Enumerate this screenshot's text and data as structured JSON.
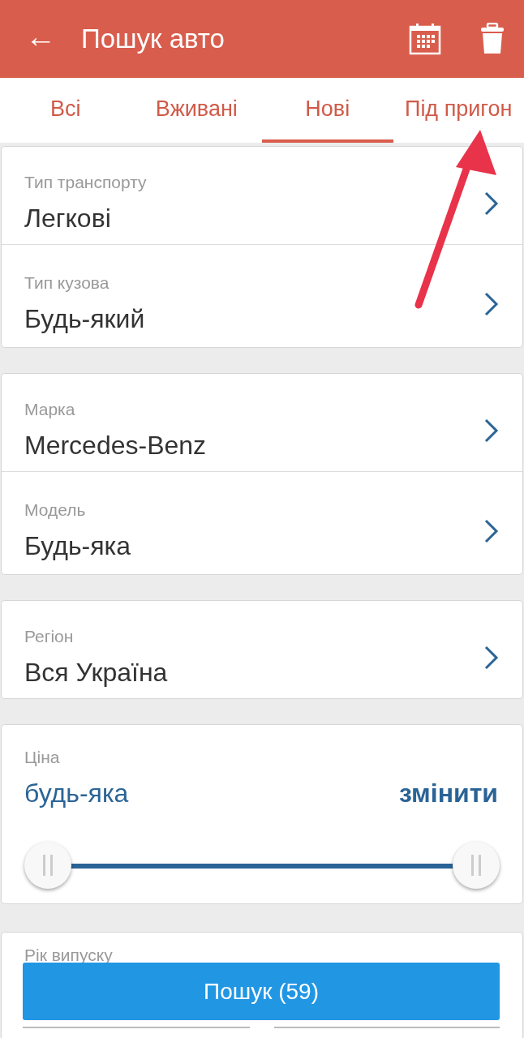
{
  "header": {
    "back": "←",
    "title": "Пошук авто"
  },
  "tabs": [
    {
      "label": "Всі",
      "selected": false
    },
    {
      "label": "Вживані",
      "selected": false
    },
    {
      "label": "Нові",
      "selected": true
    },
    {
      "label": "Під пригон",
      "selected": false
    }
  ],
  "groups": [
    {
      "rows": [
        {
          "label": "Тип транспорту",
          "value": "Легкові"
        },
        {
          "label": "Тип кузова",
          "value": "Будь-який"
        }
      ]
    },
    {
      "rows": [
        {
          "label": "Марка",
          "value": "Mercedes-Benz"
        },
        {
          "label": "Модель",
          "value": "Будь-яка"
        }
      ]
    },
    {
      "rows": [
        {
          "label": "Регіон",
          "value": "Вся Україна"
        }
      ]
    }
  ],
  "price": {
    "label": "Ціна",
    "value": "будь-яка",
    "change": "змінити",
    "handles": [
      {
        "level": 0
      },
      {
        "level": 1
      }
    ]
  },
  "year": {
    "label": "Рік випуску"
  },
  "search_button": "Пошук (59)"
}
